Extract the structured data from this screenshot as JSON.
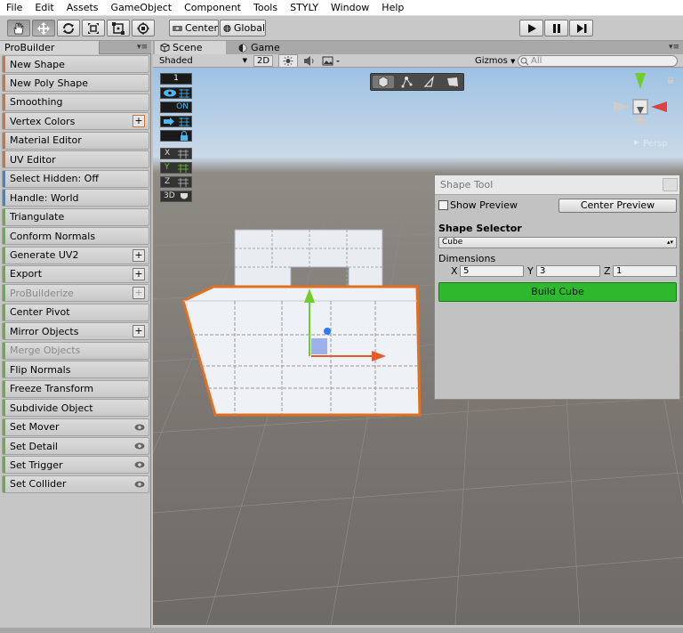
{
  "menubar": {
    "items": [
      "File",
      "Edit",
      "Assets",
      "GameObject",
      "Component",
      "Tools",
      "STYLY",
      "Window",
      "Help"
    ]
  },
  "toolbar": {
    "tools": [
      "hand-tool",
      "move-tool",
      "rotate-tool",
      "scale-tool",
      "rect-tool",
      "transform-tool"
    ],
    "pivot_label": "Center",
    "space_label": "Global",
    "play_controls": [
      "play",
      "pause",
      "step"
    ]
  },
  "probuilder": {
    "tab_label": "ProBuilder",
    "items": [
      {
        "label": "New Shape",
        "color": "#c8783a",
        "extra": "none",
        "disabled": false
      },
      {
        "label": "New Poly Shape",
        "color": "#c8783a",
        "extra": "none",
        "disabled": false
      },
      {
        "label": "Smoothing",
        "color": "#c8783a",
        "extra": "none",
        "disabled": false
      },
      {
        "label": "Vertex Colors",
        "color": "#c8783a",
        "extra": "plus-orange",
        "disabled": false
      },
      {
        "label": "Material Editor",
        "color": "#c8783a",
        "extra": "none",
        "disabled": false
      },
      {
        "label": "UV Editor",
        "color": "#c8783a",
        "extra": "none",
        "disabled": false
      },
      {
        "label": "Select Hidden: Off",
        "color": "#3a8acb",
        "extra": "none",
        "disabled": false
      },
      {
        "label": "Handle: World",
        "color": "#3a8acb",
        "extra": "none",
        "disabled": false
      },
      {
        "label": "Triangulate",
        "color": "#6cae3a",
        "extra": "none",
        "disabled": false
      },
      {
        "label": "Conform Normals",
        "color": "#6cae3a",
        "extra": "none",
        "disabled": false
      },
      {
        "label": "Generate UV2",
        "color": "#6cae3a",
        "extra": "plus",
        "disabled": false
      },
      {
        "label": "Export",
        "color": "#6cae3a",
        "extra": "plus",
        "disabled": false
      },
      {
        "label": "ProBuilderize",
        "color": "#6cae3a",
        "extra": "plus",
        "disabled": true
      },
      {
        "label": "Center Pivot",
        "color": "#6cae3a",
        "extra": "none",
        "disabled": false
      },
      {
        "label": "Mirror Objects",
        "color": "#6cae3a",
        "extra": "plus",
        "disabled": false
      },
      {
        "label": "Merge Objects",
        "color": "#6cae3a",
        "extra": "none",
        "disabled": true
      },
      {
        "label": "Flip Normals",
        "color": "#6cae3a",
        "extra": "none",
        "disabled": false
      },
      {
        "label": "Freeze Transform",
        "color": "#6cae3a",
        "extra": "none",
        "disabled": false
      },
      {
        "label": "Subdivide Object",
        "color": "#6cae3a",
        "extra": "none",
        "disabled": false
      },
      {
        "label": "Set Mover",
        "color": "#6cae3a",
        "extra": "eye",
        "disabled": false
      },
      {
        "label": "Set Detail",
        "color": "#6cae3a",
        "extra": "eye",
        "disabled": false
      },
      {
        "label": "Set Trigger",
        "color": "#6cae3a",
        "extra": "eye",
        "disabled": false
      },
      {
        "label": "Set Collider",
        "color": "#6cae3a",
        "extra": "eye",
        "disabled": false
      }
    ]
  },
  "scene": {
    "tabs": [
      {
        "label": "Scene",
        "active": true
      },
      {
        "label": "Game",
        "active": false
      }
    ],
    "shading_mode": "Shaded",
    "mode_2d": "2D",
    "gizmos_label": "Gizmos",
    "search_placeholder": "All",
    "persp_label": "Persp",
    "overlay": {
      "count_label": "1",
      "on_label": "ON",
      "axis_x": "X",
      "axis_y": "Y",
      "axis_z": "Z",
      "mode_3d": "3D"
    }
  },
  "shape_tool": {
    "title": "Shape Tool",
    "show_preview_label": "Show Preview",
    "show_preview_checked": false,
    "center_preview_label": "Center Preview",
    "selector_heading": "Shape Selector",
    "shape": "Cube",
    "dimensions_label": "Dimensions",
    "x_label": "X",
    "y_label": "Y",
    "z_label": "Z",
    "x_value": "5",
    "y_value": "3",
    "z_value": "1",
    "build_label": "Build Cube",
    "build_color": "#2db82d"
  }
}
